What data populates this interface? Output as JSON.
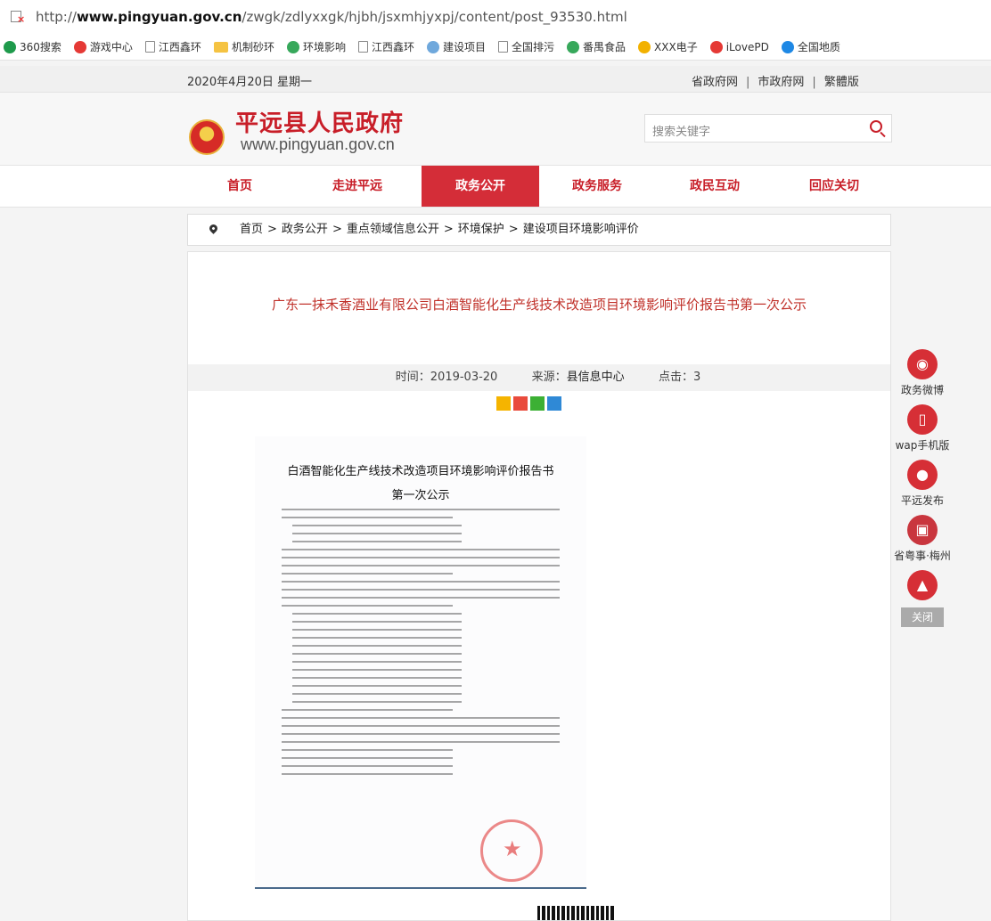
{
  "browser": {
    "url_prefix": "http://",
    "url_host": "www.pingyuan.gov.cn",
    "url_path": "/zwgk/zdlyxxgk/hjbh/jsxmhjyxpj/content/post_93530.html",
    "bookmarks": [
      {
        "label": "360搜索",
        "icon": "circle",
        "color": "#1e9a4b"
      },
      {
        "label": "游戏中心",
        "icon": "circle",
        "color": "#e53935"
      },
      {
        "label": "江西鑫环",
        "icon": "page",
        "color": "#888888"
      },
      {
        "label": "机制砂环",
        "icon": "folder",
        "color": "#f5c342"
      },
      {
        "label": "环境影响",
        "icon": "circle",
        "color": "#37a85b"
      },
      {
        "label": "江西鑫环",
        "icon": "page",
        "color": "#888888"
      },
      {
        "label": "建设项目",
        "icon": "circle",
        "color": "#6fa8dc"
      },
      {
        "label": "全国排污",
        "icon": "page",
        "color": "#888888"
      },
      {
        "label": "番禺食品",
        "icon": "circle",
        "color": "#37a85b"
      },
      {
        "label": "XXX电子",
        "icon": "circle",
        "color": "#f2b100"
      },
      {
        "label": "iLovePD",
        "icon": "circle",
        "color": "#e53935"
      },
      {
        "label": "全国地质",
        "icon": "circle",
        "color": "#1e88e5"
      }
    ]
  },
  "topbar": {
    "date": "2020年4月20日 星期一",
    "link_province": "省政府网",
    "link_city": "市政府网",
    "link_traditional": "繁體版",
    "separator": "|"
  },
  "header": {
    "site_name": "平远县人民政府",
    "site_url": "www.pingyuan.gov.cn",
    "search_placeholder": "搜索关键字"
  },
  "nav": {
    "items": [
      {
        "label": "首页",
        "active": false
      },
      {
        "label": "走进平远",
        "active": false
      },
      {
        "label": "政务公开",
        "active": true
      },
      {
        "label": "政务服务",
        "active": false
      },
      {
        "label": "政民互动",
        "active": false
      },
      {
        "label": "回应关切",
        "active": false
      }
    ]
  },
  "breadcrumb": {
    "items": [
      "首页",
      "政务公开",
      "重点领域信息公开",
      "环境保护",
      "建设项目环境影响评价"
    ],
    "separator": ">"
  },
  "article": {
    "title": "广东一抹禾香酒业有限公司白酒智能化生产线技术改造项目环境影响评价报告书第一次公示",
    "time_label": "时间：",
    "time_value": "2019-03-20",
    "source_label": "来源：",
    "source_value": "县信息中心",
    "clicks_label": "点击：",
    "clicks_value": "3",
    "document": {
      "title": "白酒智能化生产线技术改造项目环境影响评价报告书",
      "subtitle": "第一次公示"
    }
  },
  "sidebar": {
    "items": [
      {
        "label": "政务微博",
        "icon": "weibo-icon"
      },
      {
        "label": "wap手机版",
        "icon": "mobile-icon"
      },
      {
        "label": "平远发布",
        "icon": "wechat-icon"
      },
      {
        "label": "省粤事·梅州",
        "icon": "app-icon"
      },
      {
        "label": "",
        "icon": "back-to-top-icon"
      }
    ],
    "close_label": "关闭"
  },
  "colors": {
    "brand_red": "#c81e28",
    "nav_active": "#d42d38",
    "title_red": "#c0312a"
  }
}
